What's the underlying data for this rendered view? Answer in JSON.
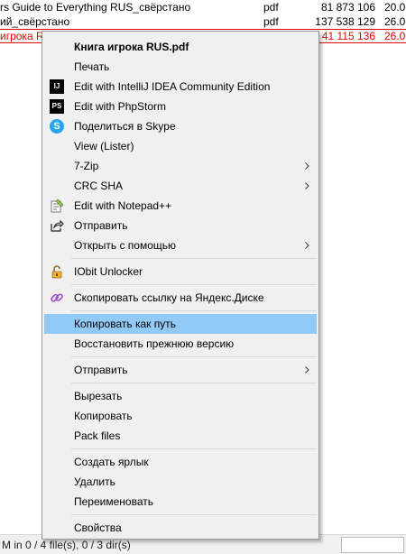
{
  "file_list": {
    "rows": [
      {
        "name": "rs Guide to Everything RUS_свёрстано",
        "ext": "pdf",
        "size": "81 873 106",
        "date": "20.0",
        "selected": false
      },
      {
        "name": "ий_свёрстано",
        "ext": "pdf",
        "size": "137 538 129",
        "date": "26.0",
        "selected": false
      },
      {
        "name": "игрока RUS",
        "ext": "pdf",
        "size": "41 115 136",
        "date": "26.0",
        "selected": true
      }
    ]
  },
  "context_menu": {
    "items": [
      {
        "label": "Книга игрока RUS.pdf",
        "bold": true,
        "icon": ""
      },
      {
        "label": "Печать",
        "icon": ""
      },
      {
        "label": "Edit with IntelliJ IDEA Community Edition",
        "icon": "intellij-idea-icon"
      },
      {
        "label": "Edit with PhpStorm",
        "icon": "phpstorm-icon"
      },
      {
        "label": "Поделиться в Skype",
        "icon": "skype-icon"
      },
      {
        "label": "View (Lister)",
        "icon": ""
      },
      {
        "label": "7-Zip",
        "submenu": true,
        "icon": ""
      },
      {
        "label": "CRC SHA",
        "submenu": true,
        "icon": ""
      },
      {
        "label": "Edit with Notepad++",
        "icon": "notepad-plus-plus-icon"
      },
      {
        "label": "Отправить",
        "icon": "share-icon"
      },
      {
        "label": "Открыть с помощью",
        "submenu": true,
        "icon": ""
      },
      {
        "label": "IObit Unlocker",
        "icon": "unlocker-icon"
      },
      {
        "label": "Скопировать ссылку на Яндекс.Диске",
        "icon": "link-icon"
      },
      {
        "label": "Копировать как путь",
        "highlighted": true,
        "icon": ""
      },
      {
        "label": "Восстановить прежнюю версию",
        "icon": ""
      },
      {
        "label": "Отправить",
        "submenu": true,
        "icon": ""
      },
      {
        "label": "Вырезать",
        "icon": ""
      },
      {
        "label": "Копировать",
        "icon": ""
      },
      {
        "label": "Pack files",
        "icon": ""
      },
      {
        "label": "Создать ярлык",
        "icon": ""
      },
      {
        "label": "Удалить",
        "icon": ""
      },
      {
        "label": "Переименовать",
        "icon": ""
      },
      {
        "label": "Свойства",
        "icon": ""
      }
    ]
  },
  "icons": {
    "intellij": "IJ",
    "phpstorm": "PS",
    "skype": "S"
  },
  "status_bar": {
    "text": "M in 0 / 4 file(s), 0 / 3 dir(s)"
  },
  "colors": {
    "selected_file": "#e00000",
    "menu_highlight": "#91c9f7",
    "menu_background": "#f0f0f0"
  }
}
